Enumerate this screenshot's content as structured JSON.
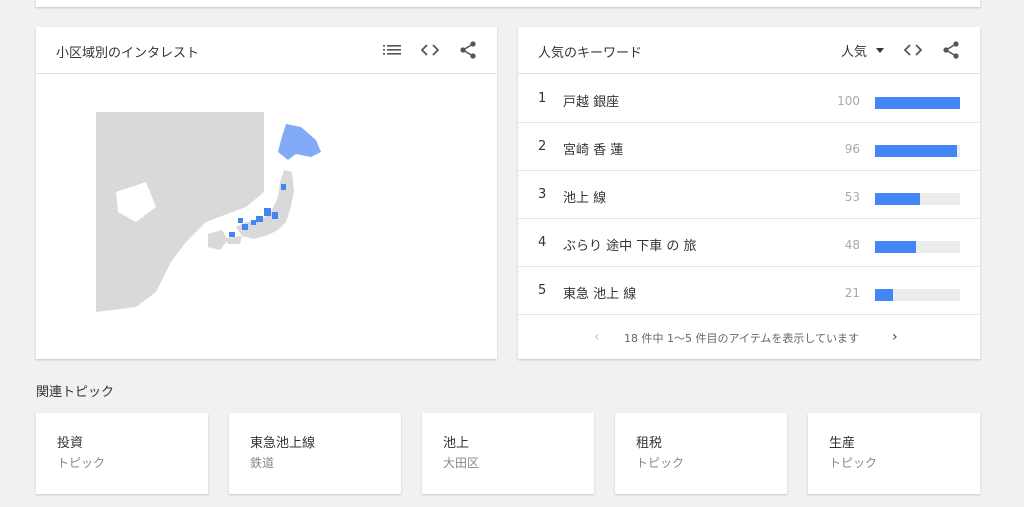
{
  "map_card": {
    "title": "小区域別のインタレスト",
    "icons": [
      "list-icon",
      "embed-icon",
      "share-icon"
    ],
    "region_color": "#4285f4",
    "region_light_color": "#82aaf6",
    "land_color": "#d9d9d9"
  },
  "keyword_card": {
    "title": "人気のキーワード",
    "sort_label": "人気",
    "icons": [
      "embed-icon",
      "share-icon"
    ],
    "bar_color": "#4285f4",
    "rows": [
      {
        "rank": "1",
        "text": "戸越 銀座",
        "value": "100",
        "level": 1.0
      },
      {
        "rank": "2",
        "text": "宮崎 香 蓮",
        "value": "96",
        "level": 0.96
      },
      {
        "rank": "3",
        "text": "池上 線",
        "value": "53",
        "level": 0.53
      },
      {
        "rank": "4",
        "text": "ぶらり 途中 下車 の 旅",
        "value": "48",
        "level": 0.48
      },
      {
        "rank": "5",
        "text": "東急 池上 線",
        "value": "21",
        "level": 0.21
      }
    ],
    "pagination": {
      "text": "18 件中 1〜5 件目のアイテムを表示しています",
      "prev": "‹",
      "next": "›"
    }
  },
  "related_topics": {
    "title": "関連トピック",
    "items": [
      {
        "name": "投資",
        "type": "トピック"
      },
      {
        "name": "東急池上線",
        "type": "鉄道"
      },
      {
        "name": "池上",
        "type": "大田区"
      },
      {
        "name": "租税",
        "type": "トピック"
      },
      {
        "name": "生産",
        "type": "トピック"
      }
    ]
  }
}
